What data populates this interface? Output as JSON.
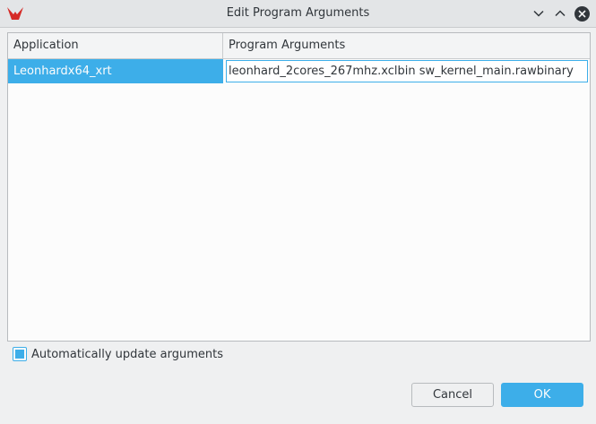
{
  "window": {
    "title": "Edit Program Arguments",
    "icon": "red-app-logo",
    "controls": [
      "minimize-icon",
      "maximize-icon",
      "close-icon"
    ]
  },
  "table": {
    "headers": [
      "Application",
      "Program Arguments"
    ],
    "rows": [
      {
        "application": "Leonhardx64_xrt",
        "arguments": "leonhard_2cores_267mhz.xclbin sw_kernel_main.rawbinary"
      }
    ]
  },
  "auto_update": {
    "label": "Automatically update arguments",
    "checked": true
  },
  "buttons": {
    "cancel": "Cancel",
    "ok": "OK"
  },
  "colors": {
    "accent": "#3daee9",
    "window_bg": "#eff0f1",
    "text": "#31363b",
    "logo": "#d52b27"
  }
}
